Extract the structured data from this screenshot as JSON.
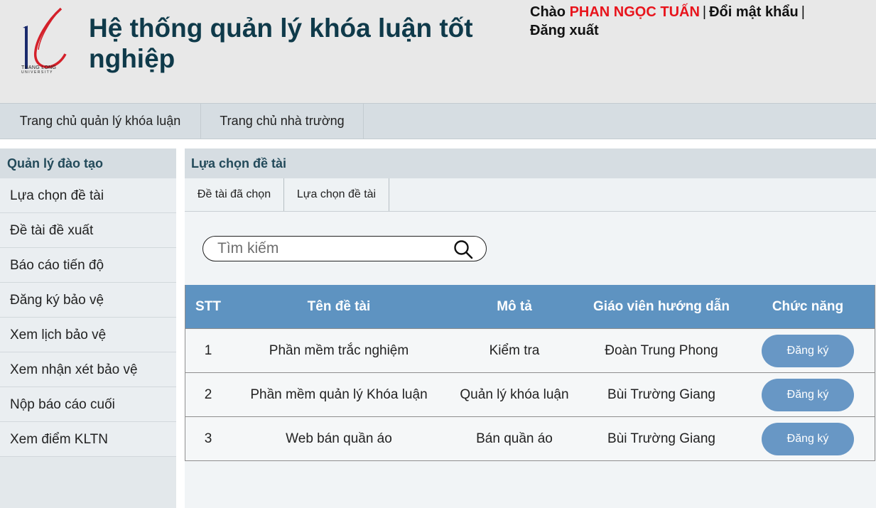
{
  "header": {
    "title": "Hệ thống quản lý khóa luận tốt nghiệp",
    "logo_line1": "THANG LONG",
    "logo_line2": "UNIVERSITY",
    "greeting": "Chào",
    "user_name": "PHAN NGỌC TUẤN",
    "change_password": "Đổi mật khẩu",
    "logout": "Đăng xuất",
    "separator": "|"
  },
  "nav": {
    "items": [
      {
        "label": "Trang chủ quản lý khóa luận"
      },
      {
        "label": "Trang chủ nhà trường"
      }
    ]
  },
  "sidebar": {
    "title": "Quản lý đào tạo",
    "items": [
      {
        "label": "Lựa chọn đề tài"
      },
      {
        "label": "Đề tài đề xuất"
      },
      {
        "label": "Báo cáo tiến độ"
      },
      {
        "label": "Đăng ký bảo vệ"
      },
      {
        "label": "Xem lịch bảo vệ"
      },
      {
        "label": "Xem nhận xét bảo vệ"
      },
      {
        "label": "Nộp báo cáo cuối"
      },
      {
        "label": "Xem điểm KLTN"
      }
    ]
  },
  "main": {
    "title": "Lựa chọn đề tài",
    "tabs": [
      {
        "label": "Đề tài đã chọn"
      },
      {
        "label": "Lựa chọn đề tài"
      }
    ],
    "search": {
      "placeholder": "Tìm kiếm",
      "value": ""
    },
    "table": {
      "headers": [
        "STT",
        "Tên đề tài",
        "Mô tả",
        "Giáo viên hướng dẫn",
        "Chức năng"
      ],
      "rows": [
        {
          "stt": "1",
          "name": "Phần mềm trắc nghiệm",
          "desc": "Kiểm tra",
          "teacher": "Đoàn Trung Phong",
          "action": "Đăng ký"
        },
        {
          "stt": "2",
          "name": "Phần mềm quản lý Khóa luận",
          "desc": "Quản lý khóa luận",
          "teacher": "Bùi Trường Giang",
          "action": "Đăng ký"
        },
        {
          "stt": "3",
          "name": "Web bán quần áo",
          "desc": "Bán quần áo",
          "teacher": "Bùi Trường Giang",
          "action": "Đăng ký"
        }
      ]
    }
  },
  "colors": {
    "title": "#0f3a4a",
    "username": "#e8141c",
    "table_header": "#5e93c1",
    "button": "#6897c5"
  },
  "icons": {
    "logo": "thang-long-logo",
    "search": "search-icon"
  }
}
